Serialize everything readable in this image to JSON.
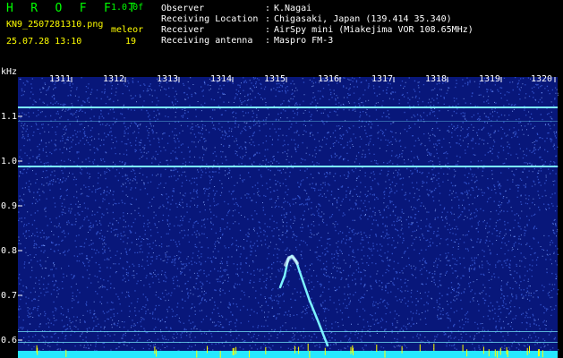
{
  "header": {
    "app_name": "H R O F F T",
    "version": "1.0.0f",
    "filename": "KN9_2507281310.png",
    "datetime": "25.07.28 13:10",
    "mode_label": "meleor",
    "count": "19",
    "fields": [
      {
        "key": "Observer",
        "value": "K.Nagai"
      },
      {
        "key": "Receiving Location",
        "value": "Chigasaki, Japan (139.414 35.340)"
      },
      {
        "key": "Receiver",
        "value": "AirSpy mini (Miakejima VOR 108.65MHz)"
      },
      {
        "key": "Receiving antenna",
        "value": "Maspro FM-3"
      }
    ]
  },
  "spectrogram": {
    "y_unit": "kHz",
    "time_ticks": [
      "1311",
      "1312",
      "1313",
      "1314",
      "1315",
      "1316",
      "1317",
      "1318",
      "1319",
      "1320"
    ],
    "freq_ticks": [
      "1.1",
      "1.0",
      "0.9",
      "0.8",
      "0.7",
      "0.6"
    ],
    "colors": {
      "background": "#08177a",
      "noise": "#3d63e0",
      "signal": "#7cf3ff",
      "baseline": "#25e8ff"
    }
  }
}
